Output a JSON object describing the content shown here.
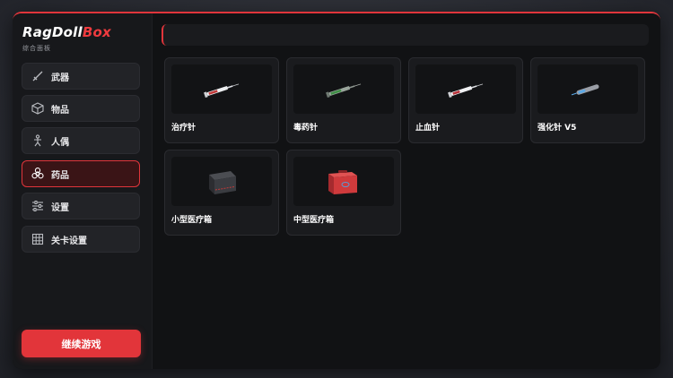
{
  "app": {
    "brand_main": "RagDoll",
    "brand_accent": "Box",
    "subtitle": "综合面板"
  },
  "sidebar": {
    "items": [
      {
        "label": "武器",
        "icon": "sword-icon",
        "active": false
      },
      {
        "label": "物品",
        "icon": "cube-icon",
        "active": false
      },
      {
        "label": "人偶",
        "icon": "person-icon",
        "active": false
      },
      {
        "label": "药品",
        "icon": "biohazard-icon",
        "active": true
      },
      {
        "label": "设置",
        "icon": "sliders-icon",
        "active": false
      },
      {
        "label": "关卡设置",
        "icon": "grid-icon",
        "active": false
      }
    ],
    "continue_label": "继续游戏"
  },
  "items": [
    {
      "label": "治疗针",
      "icon": "syringe-white-icon"
    },
    {
      "label": "毒药针",
      "icon": "syringe-green-icon"
    },
    {
      "label": "止血针",
      "icon": "syringe-red-icon"
    },
    {
      "label": "强化针 V5",
      "icon": "syringe-blue-icon"
    },
    {
      "label": "小型医疗箱",
      "icon": "small-medkit-icon"
    },
    {
      "label": "中型医疗箱",
      "icon": "medium-medkit-icon"
    }
  ],
  "colors": {
    "accent": "#e2353a",
    "panel": "#111214",
    "card": "#1a1b1e"
  }
}
